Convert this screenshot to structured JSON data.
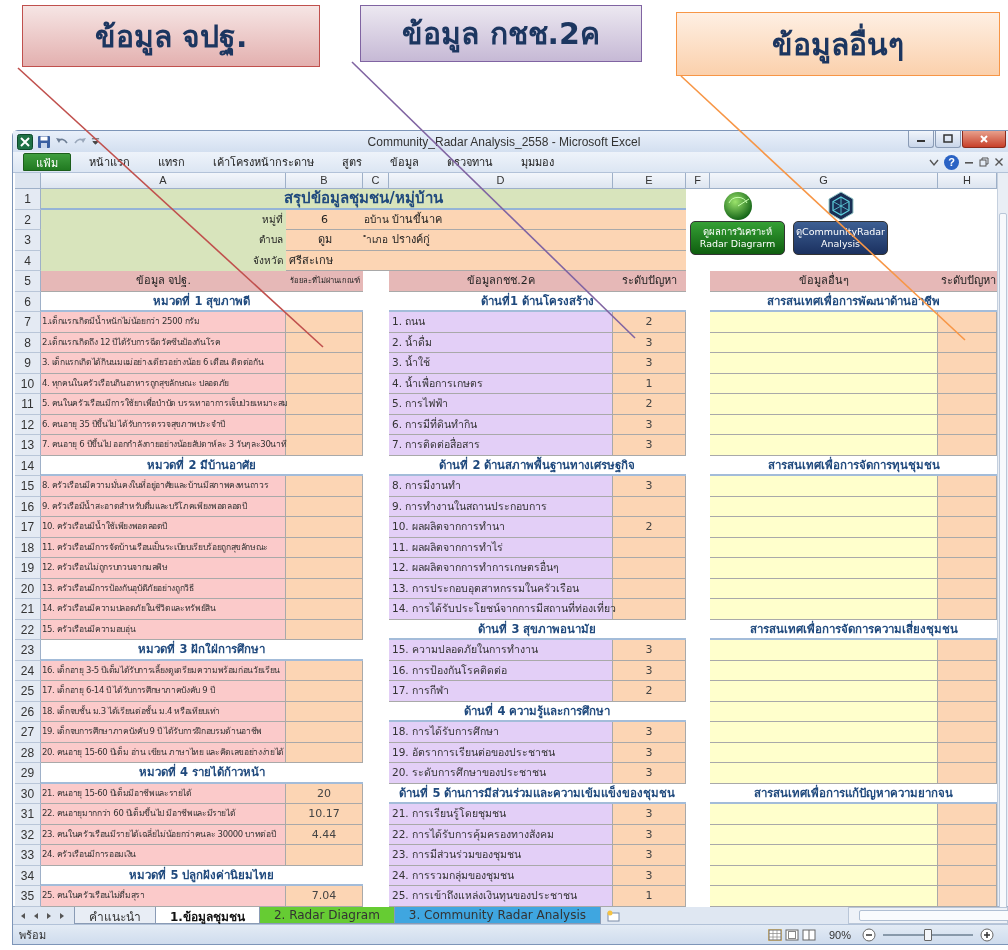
{
  "callouts": [
    {
      "text": "ข้อมูล จปฐ.",
      "color": "#c0504d"
    },
    {
      "text": "ข้อมูล กชช.2ค",
      "color": "#8064a2"
    },
    {
      "text": "ข้อมูลอื่นๆ",
      "color": "#f79646"
    }
  ],
  "window": {
    "title": "Community_Radar Analysis_2558 - Microsoft Excel"
  },
  "ribbon": {
    "file_tab": "แฟ้ม",
    "tabs": [
      "หน้าแรก",
      "แทรก",
      "เค้าโครงหน้ากระดาษ",
      "สูตร",
      "ข้อมูล",
      "ตรวจทาน",
      "มุมมอง"
    ],
    "help": "?"
  },
  "column_headers": [
    "A",
    "B",
    "C",
    "D",
    "E",
    "F",
    "G",
    "H"
  ],
  "row_numbers": [
    "1",
    "2",
    "3",
    "4",
    "5",
    "6",
    "7",
    "8",
    "9",
    "10",
    "11",
    "12",
    "13",
    "14",
    "15",
    "16",
    "17",
    "18",
    "19",
    "20",
    "21",
    "22",
    "23",
    "24",
    "25",
    "26",
    "27",
    "28",
    "29",
    "30",
    "31",
    "32",
    "33",
    "34",
    "35"
  ],
  "sheet": {
    "title": "สรุปข้อมูลชุมชน/หมู่บ้าน",
    "location": [
      {
        "label": "หมู่ที่",
        "value": "6",
        "label_2": "อบ้าน",
        "value_2": "บ้านขี้นาค"
      },
      {
        "label": "ตำบล",
        "value": "ดูม",
        "label_2": "ำเภอ",
        "value_2": "ปรางค์กู่"
      },
      {
        "label": "จังหวัด",
        "value": "ศรีสะเกษ"
      }
    ],
    "buttons": [
      {
        "kind": "radar",
        "lines": [
          "ดูผลการวิเคราะห์",
          "Radar Diagrarm"
        ]
      },
      {
        "kind": "community",
        "lines": [
          "ดูCommunityRadar",
          "Analysis"
        ]
      }
    ],
    "panels": [
      {
        "kind": "jpt",
        "header": [
          "ข้อมูล จปฐ.",
          "ร้อยละที่ไม่ผ่านเกณฑ์"
        ],
        "sections": [
          {
            "title": "หมวดที่ 1 สุขภาพดี",
            "items": [
              {
                "text": "1.เด็กแรกเกิดมีน้ำหนักไม่น้อยกว่า 2500 กรัม"
              },
              {
                "text": "2.เด็กแรกเกิดถึง 12 ปีได้รับการฉีดวัคซีนป้องกันโรค"
              },
              {
                "text": "3. เด็กแรกเกิดได้กินนมแม่อย่างเดียวอย่างน้อย 6 เดือน ติดต่อกัน"
              },
              {
                "text": "4. ทุกคนในครัวเรือนกินอาหารถูกสุขลักษณะ ปลอดภัย"
              },
              {
                "text": "5. คนในครัวเรือนมีการใช้ยาเพื่อบำบัด บรรเทาอาการเจ็บป่วยเหมาะสม"
              },
              {
                "text": "6. คนอายุ 35 ปีขึ้นไป ได้รับการตรวจสุขภาพประจำปี"
              },
              {
                "text": "7. คนอายุ 6 ปีขึ้นไป ออกกำลังกายอย่างน้อยสัปดาห์ละ 3 วันๆละ30นาที"
              }
            ]
          },
          {
            "title": "หมวดที่ 2 มีบ้านอาศัย",
            "items": [
              {
                "text": "8. ครัวเรือนมีความมั่นคงในที่อยู่อาศัยและบ้านมีสภาพคงทนถาวร"
              },
              {
                "text": "9. ครัวเรือมีน้ำสะอาดสำหรับดื่มและบริโภคเพียงพอตลอดปี"
              },
              {
                "text": "10. ครัวเรือนมีน้ำใช้เพียงพอตลอดปี"
              },
              {
                "text": "11. ครัวเรือนมีการจัดบ้านเรือนเป็นระเบียบเรียบร้อยถูกสุขลักษณะ"
              },
              {
                "text": "12. ครัวเรือนไม่ถูกรบกวนจากมลพิษ"
              },
              {
                "text": "13. ครัวเรือนมีการป้องกันอุบัติภัยอย่างถูกวิธี"
              },
              {
                "text": "14. ครัวเรือนมีความปลอดภัยในชีวิตและทรัพย์สิน"
              },
              {
                "text": "15. ครัวเรือนมีความอบอุ่น"
              }
            ]
          },
          {
            "title": "หมวดที่ 3 ฝักใฝ่การศึกษา",
            "items": [
              {
                "text": "16. เด็กอายุ 3-5 ปีเต็มได้รับการเลี้ยงดูเตรียมความพร้อมก่อนวัยเรียน"
              },
              {
                "text": "17. เด็กอายุ 6-14 ปี ได้รับการศึกษาภาคบังคับ 9 ปี"
              },
              {
                "text": "18. เด็กจบชั้น ม.3 ได้เรียนต่อชั้น ม.4 หรือเทียบเท่า"
              },
              {
                "text": "19. เด็กจบการศึกษาภาคบังคับ 9 ปี ได้รับการฝึกอบรมด้านอาชีพ"
              },
              {
                "text": "20. คนอายุ 15-60 ปีเต็ม อ่าน เขียน ภาษาไทย และคิดเลขอย่างง่ายได้"
              }
            ]
          },
          {
            "title": "หมวดที่ 4 รายได้ก้าวหน้า",
            "items": [
              {
                "text": "21. คนอายุ 15-60 ปีเต็มมีอาชีพและรายได้",
                "value": "20"
              },
              {
                "text": "22. คนอายุมากกว่า 60 ปีเต็มขึ้นไป มีอาชีพและมีรายได้",
                "value": "10.17"
              },
              {
                "text": "23. คนในครัวเรือนมีรายได้เฉลี่ยไม่น้อยกว่าคนละ 30000 บาทต่อปี",
                "value": "4.44"
              },
              {
                "text": "24. ครัวเรือนมีการออมเงิน"
              }
            ]
          },
          {
            "title": "หมวดที่ 5 ปลูกฝังค่านิยมไทย",
            "items": [
              {
                "text": "25. คนในครัวเรือนไม่ดื่มสุรา",
                "value": "7.04"
              }
            ]
          }
        ]
      },
      {
        "kind": "kchch",
        "header": [
          "ข้อมูลกชช.2ค",
          "ระดับปัญหา"
        ],
        "sections": [
          {
            "title": "ด้านที่1 ด้านโครงสร้าง",
            "items": [
              {
                "text": "1. ถนน",
                "value": "2"
              },
              {
                "text": "2. น้ำดื่ม",
                "value": "3"
              },
              {
                "text": "3. น้ำใช้",
                "value": "3"
              },
              {
                "text": "4. น้ำเพื่อการเกษตร",
                "value": "1"
              },
              {
                "text": "5. การไฟฟ้า",
                "value": "2"
              },
              {
                "text": "6. การมีที่ดินทำกิน",
                "value": "3"
              },
              {
                "text": "7. การติดต่อสื่อสาร",
                "value": "3"
              }
            ]
          },
          {
            "title": "ด้านที่ 2 ด้านสภาพพื้นฐานทางเศรษฐกิจ",
            "items": [
              {
                "text": "8. การมีงานทำ",
                "value": "3"
              },
              {
                "text": "9. การทำงานในสถานประกอบการ"
              },
              {
                "text": "10. ผลผลิตจากการทำนา",
                "value": "2"
              },
              {
                "text": "11. ผลผลิตจากการทำไร่"
              },
              {
                "text": "12. ผลผลิตจากการทำการเกษตรอื่นๆ"
              },
              {
                "text": "13. การประกอบอุตสาหกรรมในครัวเรือน"
              },
              {
                "text": "14. การได้รับประโยชน์จากการมีสถานที่ท่องเที่ยว"
              }
            ]
          },
          {
            "title": "ด้านที่ 3 สุขภาพอนามัย",
            "items": [
              {
                "text": "15. ความปลอดภัยในการทำงาน",
                "value": "3"
              },
              {
                "text": "16. การป้องกันโรคติดต่อ",
                "value": "3"
              },
              {
                "text": "17. การกีฬา",
                "value": "2"
              }
            ]
          },
          {
            "title": "ด้านที่ 4 ความรู้และการศึกษา",
            "items": [
              {
                "text": "18. การได้รับการศึกษา",
                "value": "3"
              },
              {
                "text": "19. อัตราการเรียนต่อของประชาชน",
                "value": "3"
              },
              {
                "text": "20. ระดับการศึกษาของประชาชน",
                "value": "3"
              }
            ]
          },
          {
            "title": "ด้านที่ 5 ด้านการมีส่วนร่วมและความเข้มแข็งของชุมชน",
            "items": [
              {
                "text": "21. การเรียนรู้โดยชุมชน",
                "value": "3"
              },
              {
                "text": "22. การได้รับการคุ้มครองทางสังคม",
                "value": "3"
              },
              {
                "text": "23. การมีส่วนร่วมของชุมชน",
                "value": "3"
              },
              {
                "text": "24. การรวมกลุ่มของชุมชน",
                "value": "3"
              },
              {
                "text": "25. การเข้าถึงแหล่งเงินทุนของประชาชน",
                "value": "1"
              }
            ]
          }
        ]
      },
      {
        "kind": "other",
        "header": [
          "ข้อมูลอื่นๆ",
          "ระดับปัญหา"
        ],
        "sections": [
          {
            "title": "สารสนเทศเพื่อการพัฒนาด้านอาชีพ"
          },
          {
            "title": "สารสนเทศเพื่อการจัดการทุนชุมชน"
          },
          {
            "title": "สารสนเทศเพื่อการจัดการความเสี่ยงชุมชน"
          },
          {
            "title": "สารสนเทศเพื่อการแก้ปัญหาความยากจน"
          }
        ]
      }
    ]
  },
  "sheet_tabs": [
    {
      "label": "คำแนะนำ",
      "selected": false
    },
    {
      "label": "1.ข้อมูลชุมชน",
      "selected": true
    },
    {
      "label": "2. Radar Diagram",
      "selected": false,
      "color": "#66cc33"
    },
    {
      "label": "3. Community Radar Analysis",
      "selected": false,
      "color": "#3fa6e0"
    }
  ],
  "status_bar": {
    "text": "พร้อม",
    "zoom": "90%",
    "zoom_slider": {
      "level": 0.5
    }
  }
}
